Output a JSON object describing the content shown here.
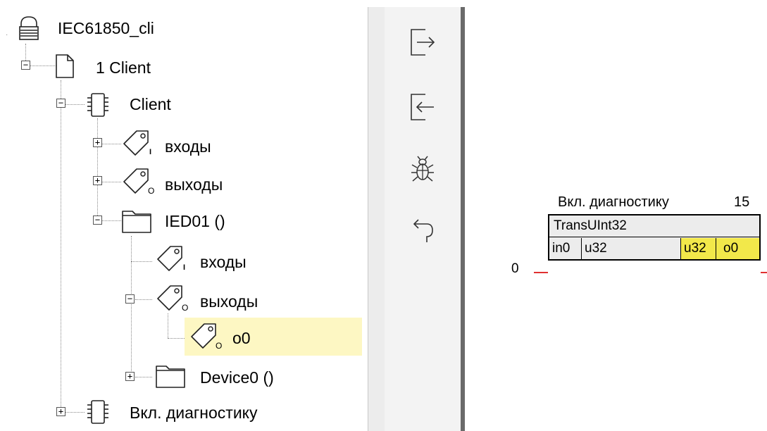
{
  "tree": {
    "root": {
      "label": "IEC61850_cli"
    },
    "items": [
      {
        "label": "1 Client",
        "toggle": "−"
      },
      {
        "label": "Client",
        "toggle": "−"
      },
      {
        "label": "входы",
        "toggle": "+",
        "badge": "I"
      },
      {
        "label": "выходы",
        "toggle": "+",
        "badge": "O"
      },
      {
        "label": "IED01 ()",
        "toggle": "−"
      },
      {
        "label": "входы",
        "badge": "I"
      },
      {
        "label": "выходы",
        "toggle": "−",
        "badge": "O"
      },
      {
        "label": "o0",
        "badge": "O"
      },
      {
        "label": "Device0 ()",
        "toggle": "+"
      },
      {
        "label": "Вкл. диагностику",
        "toggle": "+"
      }
    ]
  },
  "toolbar": {
    "buttons": [
      {
        "icon": "export-icon"
      },
      {
        "icon": "import-icon"
      },
      {
        "icon": "bug-icon"
      },
      {
        "icon": "undo-icon"
      }
    ]
  },
  "canvas": {
    "input_value": "0",
    "block": {
      "title": "Вкл. диагностику",
      "number": "15",
      "type": "TransUInt32",
      "in_port": "in0",
      "in_type": "u32",
      "out_type": "u32",
      "out_port": "o0"
    }
  },
  "colors": {
    "selection": "#fdf7c3",
    "port_highlight": "#f2e84a",
    "wire": "#e03030",
    "toolbar_divider": "#6a6a6a"
  }
}
